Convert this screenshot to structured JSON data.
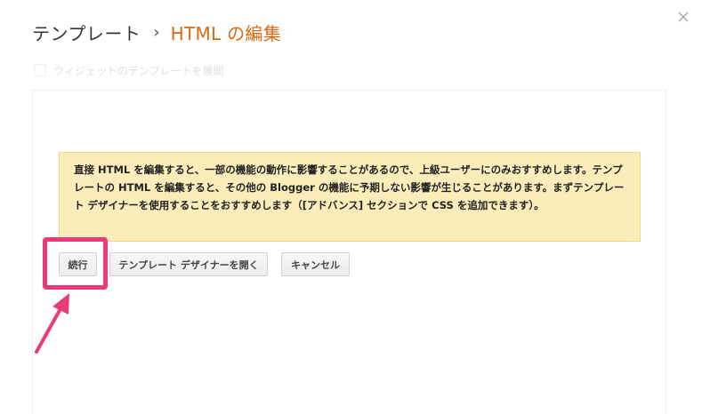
{
  "header": {
    "breadcrumb_root": "テンプレート",
    "breadcrumb_separator": "›",
    "breadcrumb_current": "HTML の編集"
  },
  "close_icon": "close-icon",
  "options": {
    "expand_widget_templates_label": "ウィジェットのテンプレートを展開",
    "expand_widget_templates_checked": false
  },
  "warning": {
    "text": "直接 HTML を編集すると、一部の機能の動作に影響することがあるので、上級ユーザーにのみおすすめします。テンプレートの HTML を編集すると、その他の Blogger の機能に予期しない影響が生じることがあります。まずテンプレート デザイナーを使用することをおすすめします（[アドバンス] セクションで CSS を追加できます）。"
  },
  "buttons": {
    "continue_label": "続行",
    "open_designer_label": "テンプレート デザイナーを開く",
    "cancel_label": "キャンセル"
  },
  "colors": {
    "breadcrumb_current": "#dd6a12",
    "warning_background": "#fbedba",
    "warning_border": "#f0d784",
    "highlight": "#ea3a77"
  }
}
